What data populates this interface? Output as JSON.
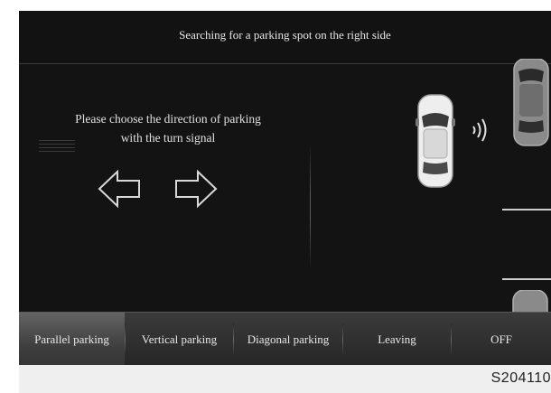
{
  "header": {
    "title": "Searching for a parking spot on the right side"
  },
  "instruction": {
    "line1": "Please choose the direction of parking",
    "line2": "with the turn signal"
  },
  "icons": {
    "turn_left": "arrow-left-outline-icon",
    "turn_right": "arrow-right-outline-icon",
    "ego_car": "car-top-view-icon",
    "sensor": "ultrasonic-sound-waves-icon"
  },
  "tabs": [
    {
      "label": "Parallel parking",
      "active": true
    },
    {
      "label": "Vertical parking",
      "active": false
    },
    {
      "label": "Diagonal parking",
      "active": false
    },
    {
      "label": "Leaving",
      "active": false
    },
    {
      "label": "OFF",
      "active": false
    }
  ],
  "footer": {
    "code": "S204110"
  },
  "colors": {
    "screen_bg": "#141414",
    "text": "#e6e6e6",
    "active_tab": "#555555"
  }
}
